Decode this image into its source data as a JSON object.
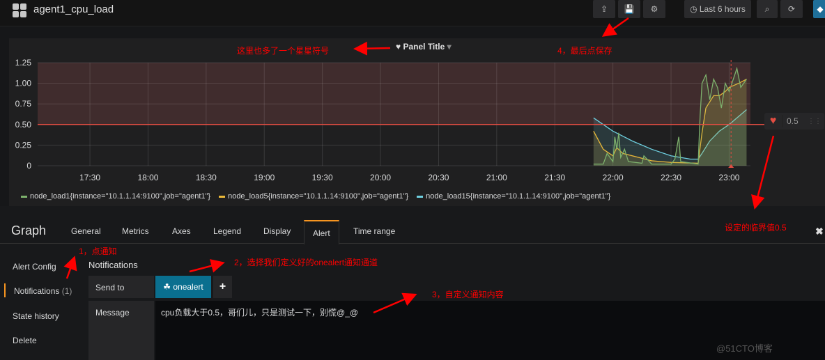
{
  "header": {
    "title": "agent1_cpu_load",
    "time_range": "Last 6 hours",
    "buttons": [
      "share-icon",
      "save-icon",
      "gear-icon",
      "zoom-out-icon",
      "refresh-icon"
    ]
  },
  "panel": {
    "title": "Panel Title",
    "threshold_value": "0.5"
  },
  "chart_data": {
    "type": "area",
    "xlim": [
      "17:03",
      "23:11"
    ],
    "ylim": [
      0,
      1.25
    ],
    "x_ticks": [
      "17:30",
      "18:00",
      "18:30",
      "19:00",
      "19:30",
      "20:00",
      "20:30",
      "21:00",
      "21:30",
      "22:00",
      "22:30",
      "23:00"
    ],
    "y_ticks": [
      "0",
      "0.25",
      "0.50",
      "0.75",
      "1.00",
      "1.25"
    ],
    "threshold": 0.5,
    "threshold_color": "#e24d42",
    "grid": true,
    "legend_placement": "bottom",
    "series": [
      {
        "name": "node_load1{instance=\"10.1.1.14:9100\",job=\"agent1\"}",
        "color": "#7eb26d",
        "points": [
          [
            "21:50",
            0.02
          ],
          [
            "21:55",
            0.02
          ],
          [
            "21:57",
            0.15
          ],
          [
            "22:00",
            0.05
          ],
          [
            "22:01",
            0.35
          ],
          [
            "22:02",
            0.2
          ],
          [
            "22:03",
            0.4
          ],
          [
            "22:04",
            0.1
          ],
          [
            "22:06",
            0.2
          ],
          [
            "22:08",
            0.05
          ],
          [
            "22:15",
            0.03
          ],
          [
            "22:16",
            0.12
          ],
          [
            "22:20",
            0.02
          ],
          [
            "22:30",
            0.02
          ],
          [
            "22:32",
            0.08
          ],
          [
            "22:34",
            0.35
          ],
          [
            "22:35",
            0.05
          ],
          [
            "22:44",
            0.02
          ],
          [
            "22:45",
            0.6
          ],
          [
            "22:46",
            1.0
          ],
          [
            "22:48",
            1.1
          ],
          [
            "22:50",
            0.8
          ],
          [
            "22:52",
            1.05
          ],
          [
            "22:54",
            0.95
          ],
          [
            "22:56",
            0.7
          ],
          [
            "22:58",
            1.0
          ],
          [
            "23:00",
            0.9
          ],
          [
            "23:04",
            1.18
          ],
          [
            "23:06",
            0.95
          ],
          [
            "23:09",
            1.05
          ]
        ]
      },
      {
        "name": "node_load5{instance=\"10.1.1.14:9100\",job=\"agent1\"}",
        "color": "#eab839",
        "points": [
          [
            "21:50",
            0.42
          ],
          [
            "21:55",
            0.2
          ],
          [
            "22:00",
            0.12
          ],
          [
            "22:02",
            0.22
          ],
          [
            "22:05",
            0.15
          ],
          [
            "22:10",
            0.12
          ],
          [
            "22:20",
            0.06
          ],
          [
            "22:30",
            0.04
          ],
          [
            "22:44",
            0.03
          ],
          [
            "22:46",
            0.4
          ],
          [
            "22:48",
            0.7
          ],
          [
            "22:52",
            0.85
          ],
          [
            "22:55",
            0.85
          ],
          [
            "22:58",
            0.9
          ],
          [
            "23:00",
            0.95
          ],
          [
            "23:05",
            1.0
          ],
          [
            "23:09",
            1.05
          ]
        ]
      },
      {
        "name": "node_load15{instance=\"10.1.1.14:9100\",job=\"agent1\"}",
        "color": "#6ed0e0",
        "points": [
          [
            "21:50",
            0.58
          ],
          [
            "22:00",
            0.42
          ],
          [
            "22:10",
            0.3
          ],
          [
            "22:20",
            0.2
          ],
          [
            "22:30",
            0.12
          ],
          [
            "22:40",
            0.08
          ],
          [
            "22:44",
            0.08
          ],
          [
            "22:46",
            0.15
          ],
          [
            "22:50",
            0.3
          ],
          [
            "22:55",
            0.42
          ],
          [
            "23:00",
            0.5
          ],
          [
            "23:05",
            0.6
          ],
          [
            "23:09",
            0.68
          ]
        ]
      }
    ]
  },
  "editor": {
    "title": "Graph",
    "tabs": [
      "General",
      "Metrics",
      "Axes",
      "Legend",
      "Display",
      "Alert",
      "Time range"
    ],
    "active_tab": "Alert",
    "side": [
      "Alert Config",
      "Notifications",
      "State history",
      "Delete"
    ],
    "notif_count": "(1)",
    "section": "Notifications",
    "send_to_label": "Send to",
    "channel": "onealert",
    "message_label": "Message",
    "message": "cpu负载大于0.5，哥们儿，只是测试一下，别慌@_@"
  },
  "annotations": {
    "star": "这里也多了一个星星符号",
    "save": "4，最后点保存",
    "threshold": "设定的临界值0.5",
    "step1": "1，点通知",
    "step2": "2，选择我们定义好的onealert通知通道",
    "step3": "3，自定义通知内容"
  },
  "watermark": "@51CTO博客"
}
